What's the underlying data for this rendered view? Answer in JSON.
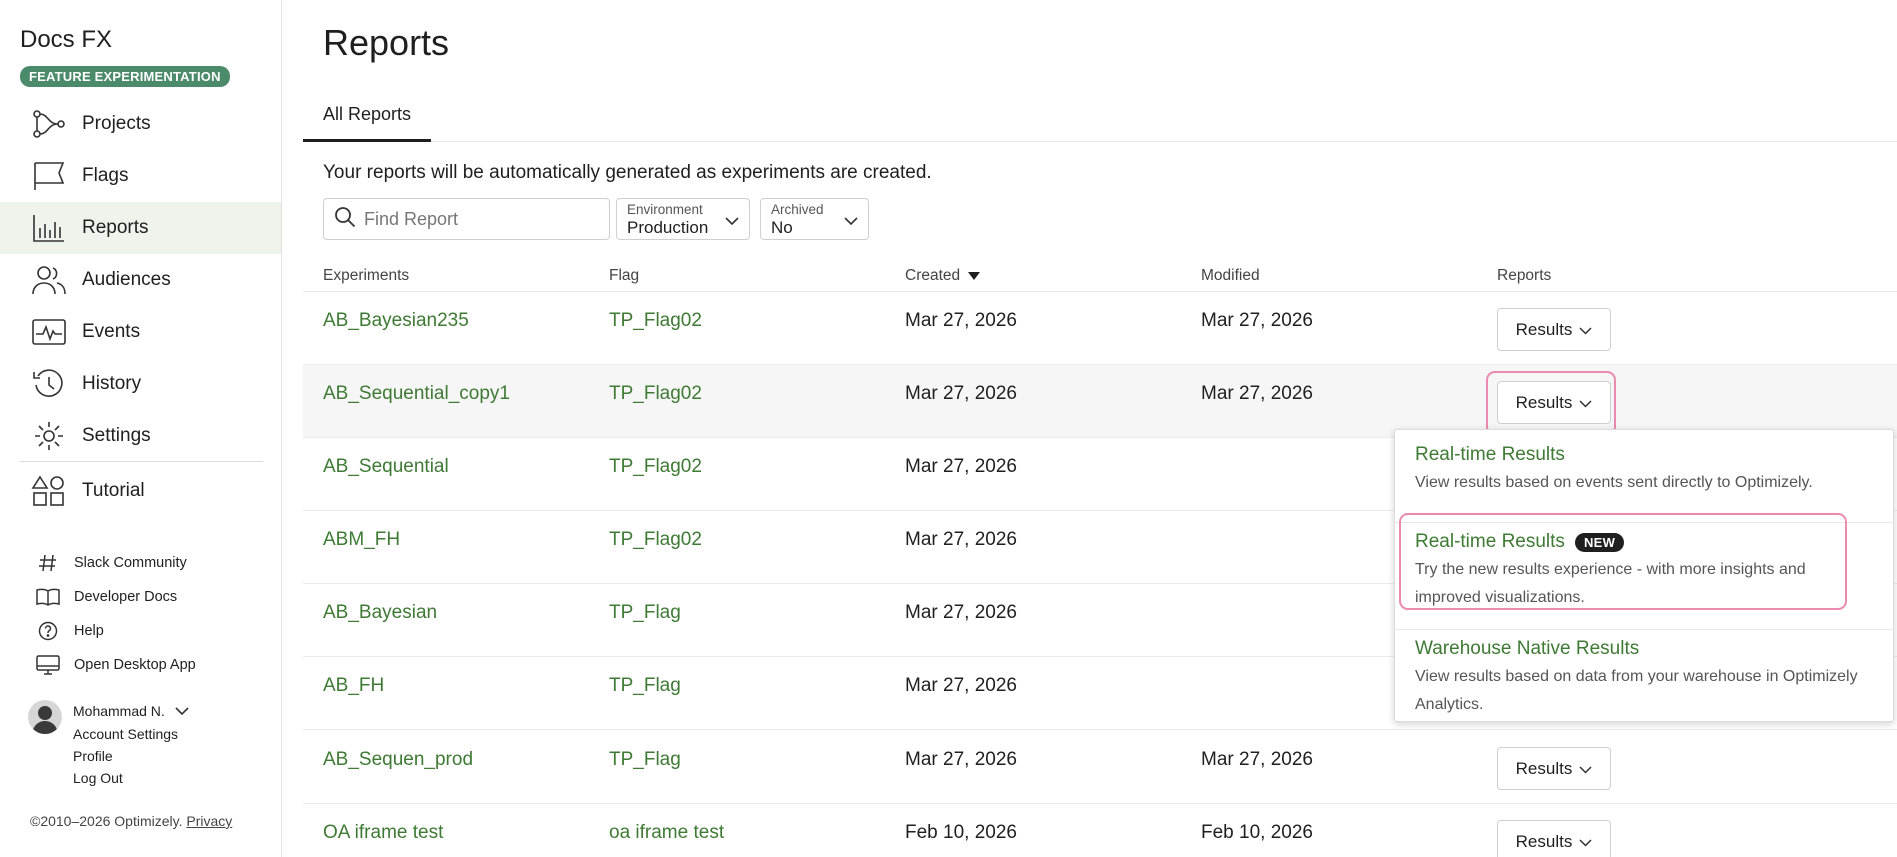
{
  "sidebar": {
    "brand": "Docs FX",
    "badge": "FEATURE EXPERIMENTATION",
    "nav": [
      {
        "label": "Projects",
        "icon": "projects-icon"
      },
      {
        "label": "Flags",
        "icon": "flag-icon"
      },
      {
        "label": "Reports",
        "icon": "reports-icon"
      },
      {
        "label": "Audiences",
        "icon": "audiences-icon"
      },
      {
        "label": "Events",
        "icon": "events-icon"
      },
      {
        "label": "History",
        "icon": "history-icon"
      },
      {
        "label": "Settings",
        "icon": "settings-icon"
      },
      {
        "label": "Tutorial",
        "icon": "tutorial-icon"
      }
    ],
    "active": "Reports",
    "aux": [
      {
        "label": "Slack Community",
        "icon": "hash-icon"
      },
      {
        "label": "Developer Docs",
        "icon": "book-icon"
      },
      {
        "label": "Help",
        "icon": "help-icon"
      },
      {
        "label": "Open Desktop App",
        "icon": "desktop-icon"
      }
    ],
    "user": {
      "name": "Mohammad N.",
      "links": [
        "Account Settings",
        "Profile",
        "Log Out"
      ]
    },
    "footer": {
      "copyright": "©2010–2026 Optimizely.",
      "privacy": "Privacy"
    }
  },
  "main": {
    "title": "Reports",
    "tab": "All Reports",
    "intro": "Your reports will be automatically generated as experiments are created.",
    "search_placeholder": "Find Report",
    "filters": {
      "environment": {
        "label": "Environment",
        "value": "Production"
      },
      "archived": {
        "label": "Archived",
        "value": "No"
      }
    },
    "columns": [
      "Experiments",
      "Flag",
      "Created",
      "Modified",
      "Reports"
    ],
    "results_label": "Results",
    "rows": [
      {
        "experiment": "AB_Bayesian235",
        "flag": "TP_Flag02",
        "created": "Mar 27, 2026",
        "modified": "Mar 27, 2026"
      },
      {
        "experiment": "AB_Sequential_copy1",
        "flag": "TP_Flag02",
        "created": "Mar 27, 2026",
        "modified": "Mar 27, 2026"
      },
      {
        "experiment": "AB_Sequential",
        "flag": "TP_Flag02",
        "created": "Mar 27, 2026",
        "modified": ""
      },
      {
        "experiment": "ABM_FH",
        "flag": "TP_Flag02",
        "created": "Mar 27, 2026",
        "modified": ""
      },
      {
        "experiment": "AB_Bayesian",
        "flag": "TP_Flag",
        "created": "Mar 27, 2026",
        "modified": ""
      },
      {
        "experiment": "AB_FH",
        "flag": "TP_Flag",
        "created": "Mar 27, 2026",
        "modified": ""
      },
      {
        "experiment": "AB_Sequen_prod",
        "flag": "TP_Flag",
        "created": "Mar 27, 2026",
        "modified": "Mar 27, 2026"
      },
      {
        "experiment": "OA iframe test",
        "flag": "oa iframe test",
        "created": "Feb 10, 2026",
        "modified": "Feb 10, 2026"
      }
    ],
    "dropdown": [
      {
        "title": "Real-time Results",
        "badge": "",
        "desc": "View results based on events sent directly to Optimizely."
      },
      {
        "title": "Real-time Results",
        "badge": "NEW",
        "desc": "Try the new results experience - with more insights and improved visualizations."
      },
      {
        "title": "Warehouse Native Results",
        "badge": "",
        "desc": "View results based on data from your warehouse in Optimizely Analytics."
      }
    ]
  },
  "colors": {
    "accent_green": "#3e7a34",
    "badge_green": "#4b8a6a",
    "highlight_pink": "#e98aae",
    "active_bg": "#eef3ec"
  }
}
